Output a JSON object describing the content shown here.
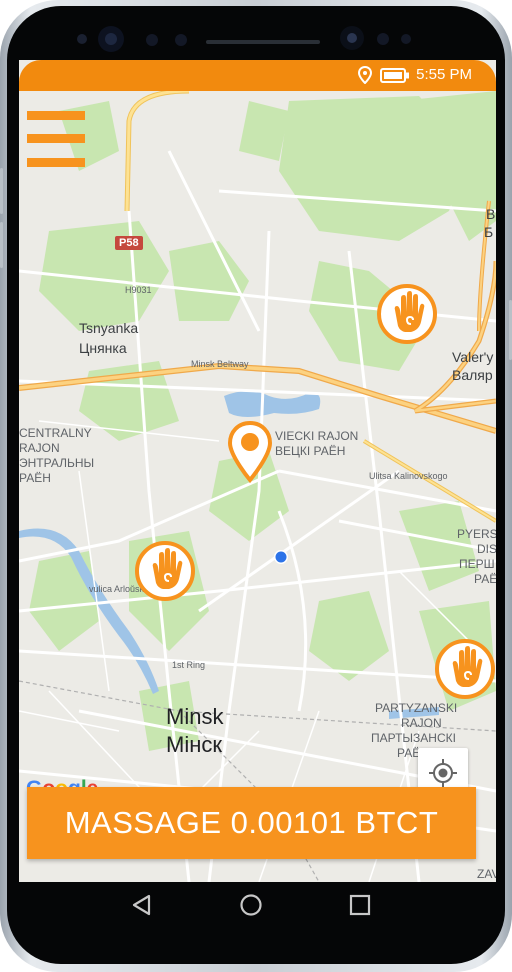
{
  "status_bar": {
    "time": "5:55 PM"
  },
  "map": {
    "labels": {
      "tsnyanka_en": "Tsnyanka",
      "tsnyanka_be": "Цнянка",
      "minsk_beltway": "Minsk Beltway",
      "road_p58": "P58",
      "road_h9031": "H9031",
      "centralny_1": "CENTRALNY",
      "centralny_2": "RAJON",
      "centralny_3": "ЭНТРАЛЬНЫ",
      "centralny_4": "РАЁН",
      "savecki_1": "VIECKI RAJON",
      "savecki_2": "ВЕЦКІ РАЁН",
      "ulitsa_kalinovskogo": "Ulitsa Kalinovskogo",
      "vulica_arlouskaja": "vulica Arloŭskaja",
      "first_ring": "1st Ring",
      "minsk_en": "Minsk",
      "minsk_be": "Мінск",
      "valery_1": "Valer'y",
      "valery_2": "Валяр",
      "b_1": "B",
      "b_2": "Б",
      "pyersh_1": "PYERS",
      "pyersh_2": "DIS",
      "pyersh_3": "ПЕРШ",
      "pyersh_4": "РАЁ",
      "partyzanski_1": "PARTYZANSKI",
      "partyzanski_2": "RAJON",
      "partyzanski_3": "ПАРТЫЗАНСКІ",
      "partyzanski_4": "РАЁН",
      "zav": "ZAV"
    },
    "google_logo": [
      "G",
      "o",
      "o",
      "g",
      "l",
      "e"
    ],
    "google_colors": [
      "#4285F4",
      "#EA4335",
      "#FBBC05",
      "#4285F4",
      "#34A853",
      "#EA4335"
    ]
  },
  "action_button": {
    "label": "MASSAGE 0.00101 BTCT"
  },
  "colors": {
    "accent": "#f7931e",
    "status_bar": "#f28a0e",
    "map_background": "#ecebe6",
    "park": "#c8e6b0",
    "water": "#9fc4e7",
    "user_dot": "#2c73e8"
  },
  "icons": {
    "menu": "hamburger-icon",
    "location_pin": "map-pin-icon",
    "massage_markers": "hand-icon",
    "my_location": "crosshair-icon",
    "status_location": "location-icon",
    "battery": "battery-icon",
    "nav_back": "back-triangle-icon",
    "nav_home": "home-circle-icon",
    "nav_recents": "recents-square-icon"
  }
}
